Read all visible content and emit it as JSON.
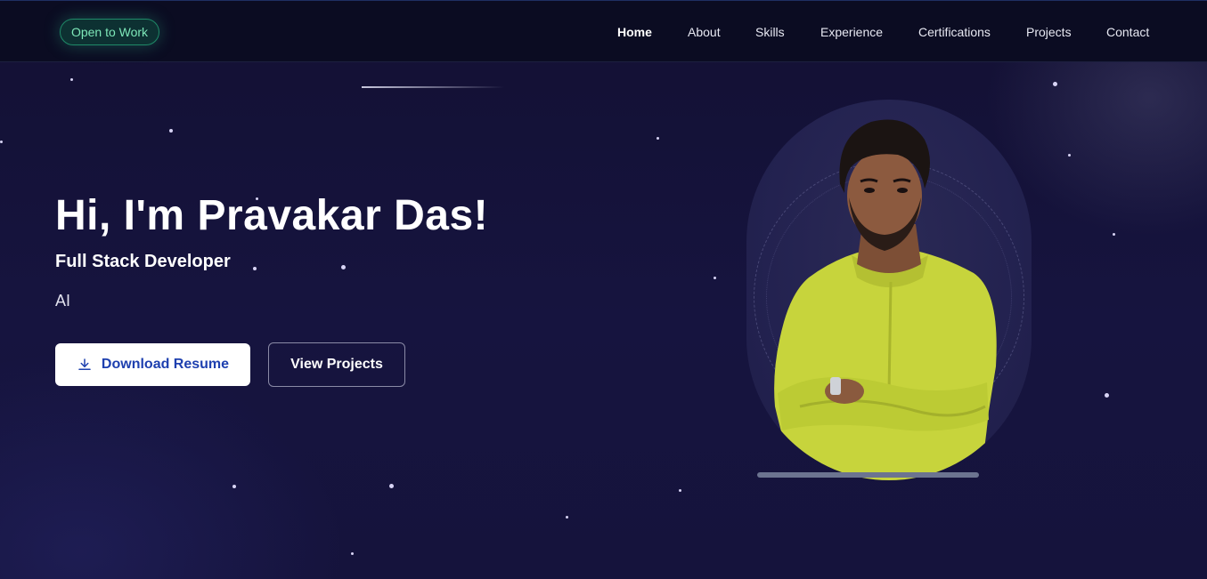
{
  "nav": {
    "badge": "Open to Work",
    "links": [
      {
        "label": "Home",
        "active": true
      },
      {
        "label": "About",
        "active": false
      },
      {
        "label": "Skills",
        "active": false
      },
      {
        "label": "Experience",
        "active": false
      },
      {
        "label": "Certifications",
        "active": false
      },
      {
        "label": "Projects",
        "active": false
      },
      {
        "label": "Contact",
        "active": false
      }
    ]
  },
  "hero": {
    "title": "Hi, I'm Pravakar Das!",
    "subtitle": "Full Stack Developer",
    "typed_text": "AI",
    "primary_button": {
      "label": "Download Resume",
      "icon": "download-icon"
    },
    "secondary_button": {
      "label": "View Projects"
    }
  },
  "colors": {
    "background": "#14123a",
    "nav_background": "#0b0c22",
    "badge_accent": "#7ee8b9",
    "primary_button_text": "#1e40af",
    "shirt": "#c9d63c"
  }
}
